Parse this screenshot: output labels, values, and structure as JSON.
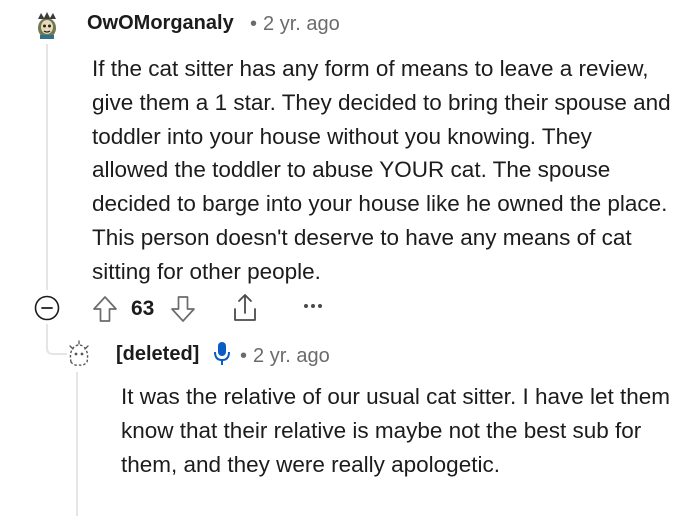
{
  "comment": {
    "username": "OwOMorganaly",
    "separator": "•",
    "age": "2 yr. ago",
    "body": "If the cat sitter has any form of means to leave a review, give them a 1 star. They decided to bring their spouse and toddler into your house without you knowing. They allowed the toddler to abuse YOUR cat. The spouse decided to barge into your house like he owned the place. This person doesn't deserve to have any means of cat sitting for other people.",
    "votes": "63",
    "icons": {
      "avatar": "user-avatar-icon",
      "collapse": "collapse-minus-icon",
      "upvote": "upvote-arrow-icon",
      "downvote": "downvote-arrow-icon",
      "share": "share-icon",
      "more": "more-dots-icon"
    }
  },
  "reply": {
    "username": "[deleted]",
    "separator": "•",
    "age": "2 yr. ago",
    "body": "It was the relative of our usual cat sitter. I have let them know that their relative is maybe not the best sub for them, and they were really apologetic.",
    "icons": {
      "avatar": "deleted-user-avatar-icon",
      "op_badge": "microphone-icon"
    }
  },
  "colors": {
    "text": "#1c1c1c",
    "meta": "#6b6b6b",
    "thread_line": "#e5e5e5",
    "op_badge": "#0a5cc2"
  }
}
